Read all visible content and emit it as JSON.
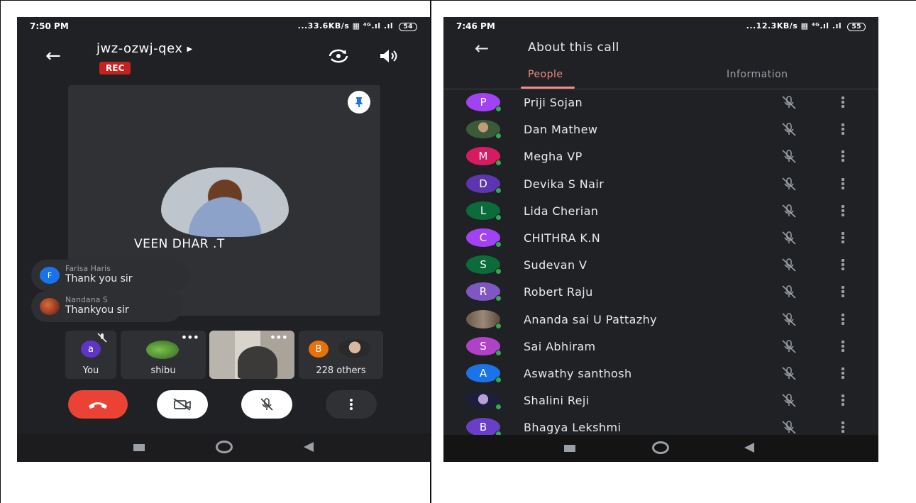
{
  "left_phone": {
    "status": {
      "time": "7:50 PM",
      "network": "...33.6KB/s",
      "battery": "54"
    },
    "meeting_code": "jwz-ozwj-qex",
    "rec_label": "REC",
    "speaker_name": "VEEN DHAR .T",
    "chats": [
      {
        "initial": "F",
        "name": "Farisa Haris",
        "message": "Thank you sir",
        "color": "#1a73e8"
      },
      {
        "initial": "",
        "name": "Nandana S",
        "message": "Thankyou sir",
        "color": "#8b3a2a"
      }
    ],
    "tiles": [
      {
        "initial": "a",
        "label": "You",
        "color": "#5f35c8"
      },
      {
        "initial": "",
        "label": "shibu",
        "color": "#3d8b3a"
      },
      {
        "initial": "",
        "label": "",
        "color": "#8a8a8a"
      },
      {
        "initial": "B",
        "label": "228 others",
        "color": "#e8710a"
      }
    ],
    "icons": [
      "arrow-left-icon",
      "camera-switch-icon",
      "speaker-icon",
      "pin-icon",
      "end-call-icon",
      "video-off-icon",
      "mic-off-icon",
      "more-vert-icon"
    ],
    "colors": {
      "end_call": "#ea4335",
      "rec": "#c5221f",
      "background": "#202124"
    }
  },
  "right_phone": {
    "status": {
      "time": "7:46 PM",
      "network": "...12.3KB/s",
      "battery": "55"
    },
    "title": "About this call",
    "tabs": [
      "People",
      "Information"
    ],
    "people": [
      {
        "initial": "P",
        "name": "Priji Sojan",
        "color": "#a142f4"
      },
      {
        "initial": "",
        "name": "Dan Mathew",
        "color": "#6d7c5a"
      },
      {
        "initial": "M",
        "name": "Megha VP",
        "color": "#d81b60"
      },
      {
        "initial": "D",
        "name": "Devika S Nair",
        "color": "#5e35b1"
      },
      {
        "initial": "L",
        "name": "Lida Cherian",
        "color": "#0b6b3a"
      },
      {
        "initial": "C",
        "name": "CHITHRA K.N",
        "color": "#a142f4"
      },
      {
        "initial": "S",
        "name": "Sudevan V",
        "color": "#0b6b3a"
      },
      {
        "initial": "R",
        "name": "Robert Raju",
        "color": "#7e57c2"
      },
      {
        "initial": "",
        "name": "Ananda sai U Pattazhy",
        "color": "#7a6a5a"
      },
      {
        "initial": "S",
        "name": "Sai Abhiram",
        "color": "#b041c9"
      },
      {
        "initial": "A",
        "name": "Aswathy santhosh",
        "color": "#1a73e8"
      },
      {
        "initial": "",
        "name": "Shalini Reji",
        "color": "#3b3f6e"
      },
      {
        "initial": "B",
        "name": "Bhagya Lekshmi",
        "color": "#6a3fc7"
      }
    ],
    "colors": {
      "active_tab": "#f28b82",
      "online_dot": "#34a853"
    }
  }
}
